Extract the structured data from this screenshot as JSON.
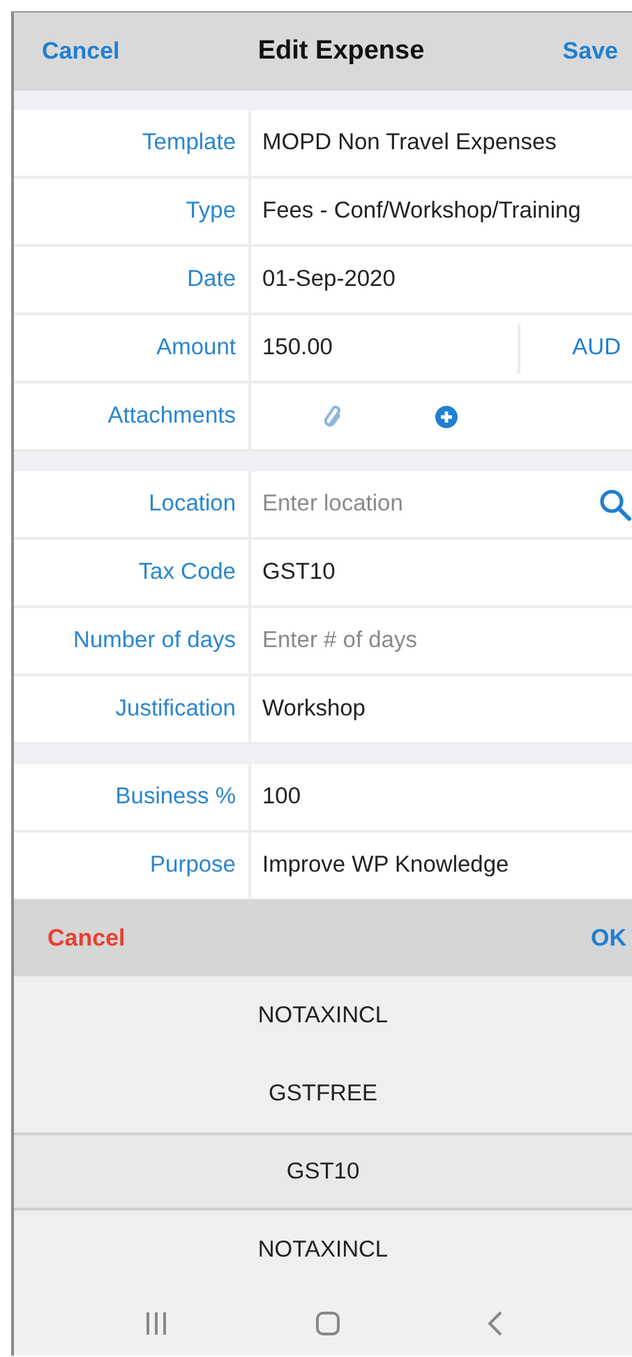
{
  "header": {
    "cancel": "Cancel",
    "title": "Edit Expense",
    "save": "Save"
  },
  "sections": [
    {
      "rows": [
        {
          "kind": "value",
          "label": "Template",
          "value": "MOPD Non Travel Expenses"
        },
        {
          "kind": "value",
          "label": "Type",
          "value": "Fees - Conf/Workshop/Training"
        },
        {
          "kind": "value",
          "label": "Date",
          "value": "01-Sep-2020"
        },
        {
          "kind": "amount",
          "label": "Amount",
          "value": "150.00",
          "currency": "AUD"
        },
        {
          "kind": "attachments",
          "label": "Attachments"
        }
      ]
    },
    {
      "rows": [
        {
          "kind": "search",
          "label": "Location",
          "placeholder": "Enter location"
        },
        {
          "kind": "value",
          "label": "Tax Code",
          "value": "GST10"
        },
        {
          "kind": "input",
          "label": "Number of days",
          "placeholder": "Enter # of days"
        },
        {
          "kind": "value",
          "label": "Justification",
          "value": "Workshop"
        }
      ]
    },
    {
      "rows": [
        {
          "kind": "value",
          "label": "Business %",
          "value": "100"
        },
        {
          "kind": "value",
          "label": "Purpose",
          "value": "Improve WP Knowledge"
        }
      ]
    }
  ],
  "picker": {
    "cancel": "Cancel",
    "ok": "OK",
    "options": [
      {
        "label": "NOTAXINCL",
        "selected": false
      },
      {
        "label": "GSTFREE",
        "selected": false
      },
      {
        "label": "GST10",
        "selected": true
      },
      {
        "label": "NOTAXINCL",
        "selected": false
      }
    ]
  }
}
